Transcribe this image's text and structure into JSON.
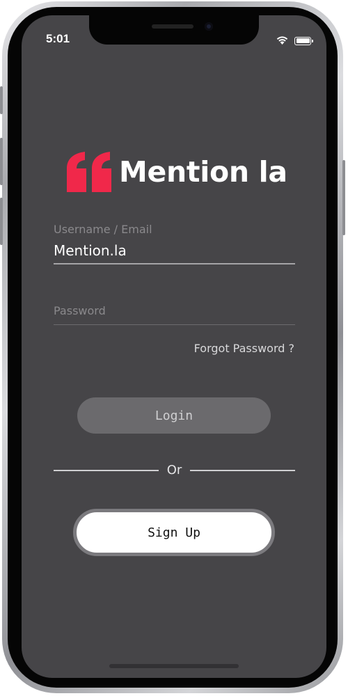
{
  "status_bar": {
    "time": "5:01"
  },
  "logo": {
    "text": "Mention la",
    "accent_color": "#f0284a"
  },
  "form": {
    "username_label": "Username / Email",
    "username_value": "Mention.la",
    "password_label": "Password",
    "password_value": "",
    "forgot_password": "Forgot Password ?"
  },
  "actions": {
    "login_label": "Login",
    "or_text": "Or",
    "signup_label": "Sign Up"
  },
  "colors": {
    "screen_background": "#464548",
    "login_button": "#6b6a6d",
    "signup_button": "#ffffff"
  }
}
